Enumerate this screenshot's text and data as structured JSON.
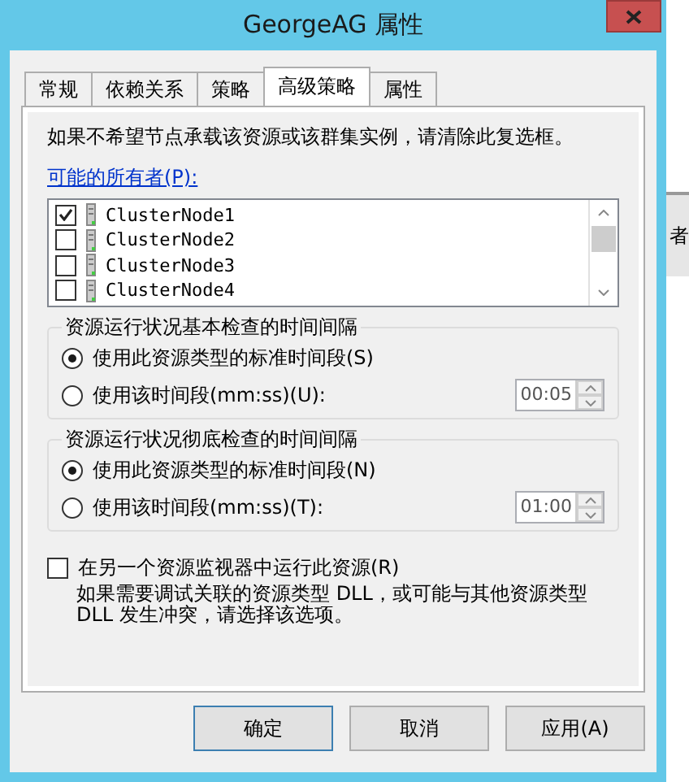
{
  "window": {
    "title": "GeorgeAG 属性"
  },
  "tabs": [
    {
      "label": "常规",
      "selected": false
    },
    {
      "label": "依赖关系",
      "selected": false
    },
    {
      "label": "策略",
      "selected": false
    },
    {
      "label": "高级策略",
      "selected": true
    },
    {
      "label": "属性",
      "selected": false
    }
  ],
  "panel": {
    "description": "如果不希望节点承载该资源或该群集实例，请清除此复选框。",
    "owners_label": "可能的所有者(P):",
    "owners": [
      {
        "name": "ClusterNode1",
        "checked": true
      },
      {
        "name": "ClusterNode2",
        "checked": false
      },
      {
        "name": "ClusterNode3",
        "checked": false
      },
      {
        "name": "ClusterNode4",
        "checked": false
      }
    ],
    "groups": [
      {
        "title": "资源运行状况基本检查的时间间隔",
        "options": [
          {
            "label": "使用此资源类型的标准时间段(S)",
            "selected": true
          },
          {
            "label": "使用该时间段(mm:ss)(U):",
            "selected": false
          }
        ],
        "time_value": "00:05"
      },
      {
        "title": "资源运行状况彻底检查的时间间隔",
        "options": [
          {
            "label": "使用此资源类型的标准时间段(N)",
            "selected": true
          },
          {
            "label": "使用该时间段(mm:ss)(T):",
            "selected": false
          }
        ],
        "time_value": "01:00"
      }
    ],
    "separate_monitor": {
      "label": "在另一个资源监视器中运行此资源(R)",
      "checked": false,
      "description": "如果需要调试关联的资源类型 DLL，或可能与其他资源类型 DLL 发生冲突，请选择该选项。"
    }
  },
  "buttons": [
    {
      "label": "确定",
      "default": true
    },
    {
      "label": "取消",
      "default": false
    },
    {
      "label": "应用(A)",
      "default": false
    }
  ],
  "background_fragment": "者"
}
